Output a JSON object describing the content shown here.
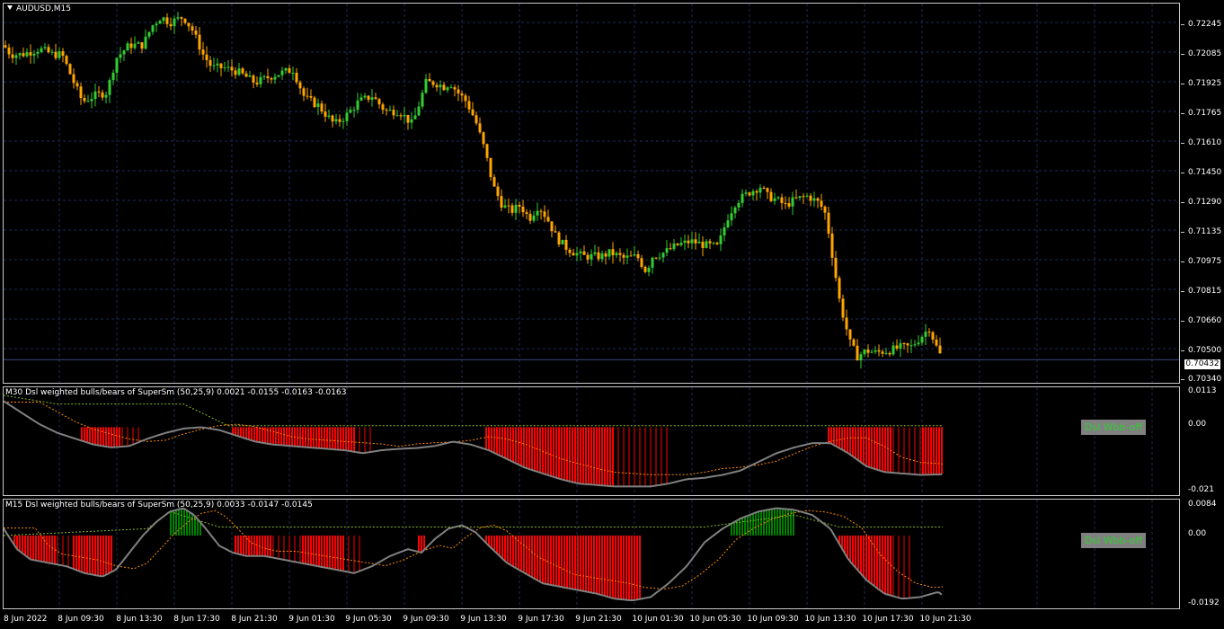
{
  "symbol": "AUDUSD,M15",
  "colors": {
    "bull": "#32cd32",
    "bear": "#ffa500",
    "grid": "#1e2a5a",
    "hist_red": "#ff0000",
    "hist_green": "#008000",
    "signal_line": "#808080",
    "dashed": "#ff8c00",
    "green_dashed": "#8bb821"
  },
  "price_axis": {
    "labels": [
      "0.72245",
      "0.72085",
      "0.71925",
      "0.71765",
      "0.71610",
      "0.71450",
      "0.71290",
      "0.71135",
      "0.70975",
      "0.70815",
      "0.70660",
      "0.70500",
      "0.70340"
    ],
    "current": "0.70432"
  },
  "indicator1": {
    "title": "M30 Dsl weighted bulls/bears of SuperSm (50,25,9) 0.0021 -0.0155 -0.0163 -0.0163",
    "levels": [
      "0.0113",
      "0.00",
      "-0.021"
    ],
    "badge": "Dsl Wbb-off"
  },
  "indicator2": {
    "title": "M15 Dsl weighted bulls/bears of SuperSm (50,25,9) 0.0033 -0.0147 -0.0145",
    "levels": [
      "0.0084",
      "0.00",
      "-0.0192"
    ],
    "badge": "Dsl Wbb-off"
  },
  "time_axis": [
    "8 Jun 2022",
    "8 Jun 09:30",
    "8 Jun 13:30",
    "8 Jun 17:30",
    "8 Jun 21:30",
    "9 Jun 01:30",
    "9 Jun 05:30",
    "9 Jun 09:30",
    "9 Jun 13:30",
    "9 Jun 17:30",
    "9 Jun 21:30",
    "10 Jun 01:30",
    "10 Jun 05:30",
    "10 Jun 09:30",
    "10 Jun 13:30",
    "10 Jun 17:30",
    "10 Jun 21:30"
  ],
  "chart_data": [
    {
      "type": "candlestick",
      "title": "AUDUSD,M15",
      "ylim": [
        0.703,
        0.7232
      ],
      "price_path_x": [
        0,
        8,
        20,
        40,
        55,
        65,
        80,
        88,
        100,
        115,
        125,
        140,
        155,
        165,
        175,
        185,
        200,
        210,
        222,
        232,
        245,
        260,
        280,
        300,
        322,
        335,
        350,
        368,
        380,
        395,
        410,
        425,
        440,
        455,
        470,
        480,
        490,
        497,
        505,
        515,
        525,
        535,
        545,
        555,
        565,
        575,
        585,
        595,
        605,
        615,
        625,
        635,
        645,
        655,
        665,
        675,
        690,
        705,
        715,
        722,
        735,
        750,
        765,
        780,
        795,
        805,
        815,
        830,
        842,
        850,
        860,
        870,
        880,
        895,
        908,
        915,
        920,
        925,
        930,
        935,
        942,
        950,
        960,
        970,
        985,
        1000,
        1010,
        1020,
        1030,
        1038,
        1045
      ],
      "price_path_y": [
        0.721,
        0.7205,
        0.7205,
        0.7208,
        0.7205,
        0.7205,
        0.7188,
        0.718,
        0.7183,
        0.7185,
        0.7203,
        0.721,
        0.721,
        0.722,
        0.7225,
        0.7222,
        0.7225,
        0.7218,
        0.7205,
        0.7198,
        0.7198,
        0.7196,
        0.719,
        0.7194,
        0.7197,
        0.7182,
        0.7178,
        0.7168,
        0.7172,
        0.718,
        0.7183,
        0.7175,
        0.7175,
        0.7168,
        0.719,
        0.719,
        0.7188,
        0.719,
        0.7185,
        0.718,
        0.717,
        0.7155,
        0.7135,
        0.7125,
        0.7122,
        0.7125,
        0.7118,
        0.7125,
        0.7118,
        0.7108,
        0.7103,
        0.71,
        0.7098,
        0.7098,
        0.7098,
        0.71,
        0.7097,
        0.7098,
        0.709,
        0.7098,
        0.71,
        0.7104,
        0.7106,
        0.7104,
        0.7103,
        0.7118,
        0.7127,
        0.7132,
        0.7135,
        0.713,
        0.7128,
        0.7125,
        0.7128,
        0.713,
        0.7126,
        0.712,
        0.7105,
        0.709,
        0.7075,
        0.7065,
        0.7052,
        0.7045,
        0.7048,
        0.7047,
        0.7048,
        0.705,
        0.705,
        0.7055,
        0.706,
        0.705,
        0.7043
      ]
    },
    {
      "type": "bar",
      "title": "M30 Dsl weighted bulls/bears of SuperSm (50,25,9)",
      "ylim": [
        -0.021,
        0.0113
      ],
      "line_x": [
        0,
        20,
        40,
        60,
        80,
        100,
        120,
        140,
        160,
        180,
        200,
        220,
        240,
        260,
        280,
        300,
        320,
        340,
        360,
        380,
        400,
        420,
        440,
        460,
        480,
        500,
        520,
        540,
        560,
        580,
        600,
        620,
        640,
        660,
        680,
        700,
        720,
        740,
        760,
        780,
        800,
        820,
        840,
        860,
        880,
        900,
        920,
        940,
        960,
        980,
        1000,
        1020,
        1045
      ],
      "line_y": [
        0.009,
        0.005,
        0.001,
        -0.002,
        -0.004,
        -0.006,
        -0.007,
        -0.0065,
        -0.004,
        -0.002,
        -0.0005,
        0.0,
        -0.001,
        -0.003,
        -0.005,
        -0.006,
        -0.0065,
        -0.007,
        -0.0075,
        -0.008,
        -0.009,
        -0.008,
        -0.0075,
        -0.0072,
        -0.0065,
        -0.005,
        -0.006,
        -0.008,
        -0.011,
        -0.014,
        -0.016,
        -0.018,
        -0.0195,
        -0.02,
        -0.0205,
        -0.0205,
        -0.0205,
        -0.0195,
        -0.018,
        -0.0175,
        -0.0165,
        -0.015,
        -0.012,
        -0.009,
        -0.007,
        -0.0055,
        -0.0055,
        -0.009,
        -0.0135,
        -0.0155,
        -0.016,
        -0.0165,
        -0.0163
      ]
    },
    {
      "type": "bar",
      "title": "M15 Dsl weighted bulls/bears of SuperSm (50,25,9)",
      "ylim": [
        -0.0192,
        0.0084
      ],
      "line_x": [
        0,
        15,
        30,
        50,
        70,
        90,
        110,
        125,
        140,
        155,
        170,
        185,
        200,
        212,
        225,
        240,
        255,
        270,
        290,
        310,
        330,
        350,
        370,
        390,
        410,
        430,
        450,
        465,
        480,
        495,
        510,
        525,
        540,
        560,
        580,
        600,
        620,
        640,
        660,
        680,
        700,
        720,
        740,
        760,
        780,
        800,
        820,
        840,
        860,
        880,
        900,
        920,
        940,
        960,
        980,
        1000,
        1020,
        1040,
        1045
      ],
      "line_y": [
        0.002,
        -0.004,
        -0.007,
        -0.008,
        -0.009,
        -0.011,
        -0.012,
        -0.01,
        -0.005,
        0.0,
        0.004,
        0.007,
        0.008,
        0.006,
        0.002,
        -0.003,
        -0.005,
        -0.006,
        -0.006,
        -0.007,
        -0.008,
        -0.009,
        -0.01,
        -0.011,
        -0.009,
        -0.006,
        -0.004,
        -0.005,
        -0.001,
        0.002,
        0.003,
        0.001,
        -0.003,
        -0.008,
        -0.011,
        -0.014,
        -0.015,
        -0.016,
        -0.017,
        -0.0185,
        -0.019,
        -0.018,
        -0.014,
        -0.009,
        -0.002,
        0.002,
        0.005,
        0.007,
        0.008,
        0.0075,
        0.006,
        0.002,
        -0.007,
        -0.013,
        -0.017,
        -0.0185,
        -0.018,
        -0.0165,
        -0.0175
      ]
    }
  ]
}
